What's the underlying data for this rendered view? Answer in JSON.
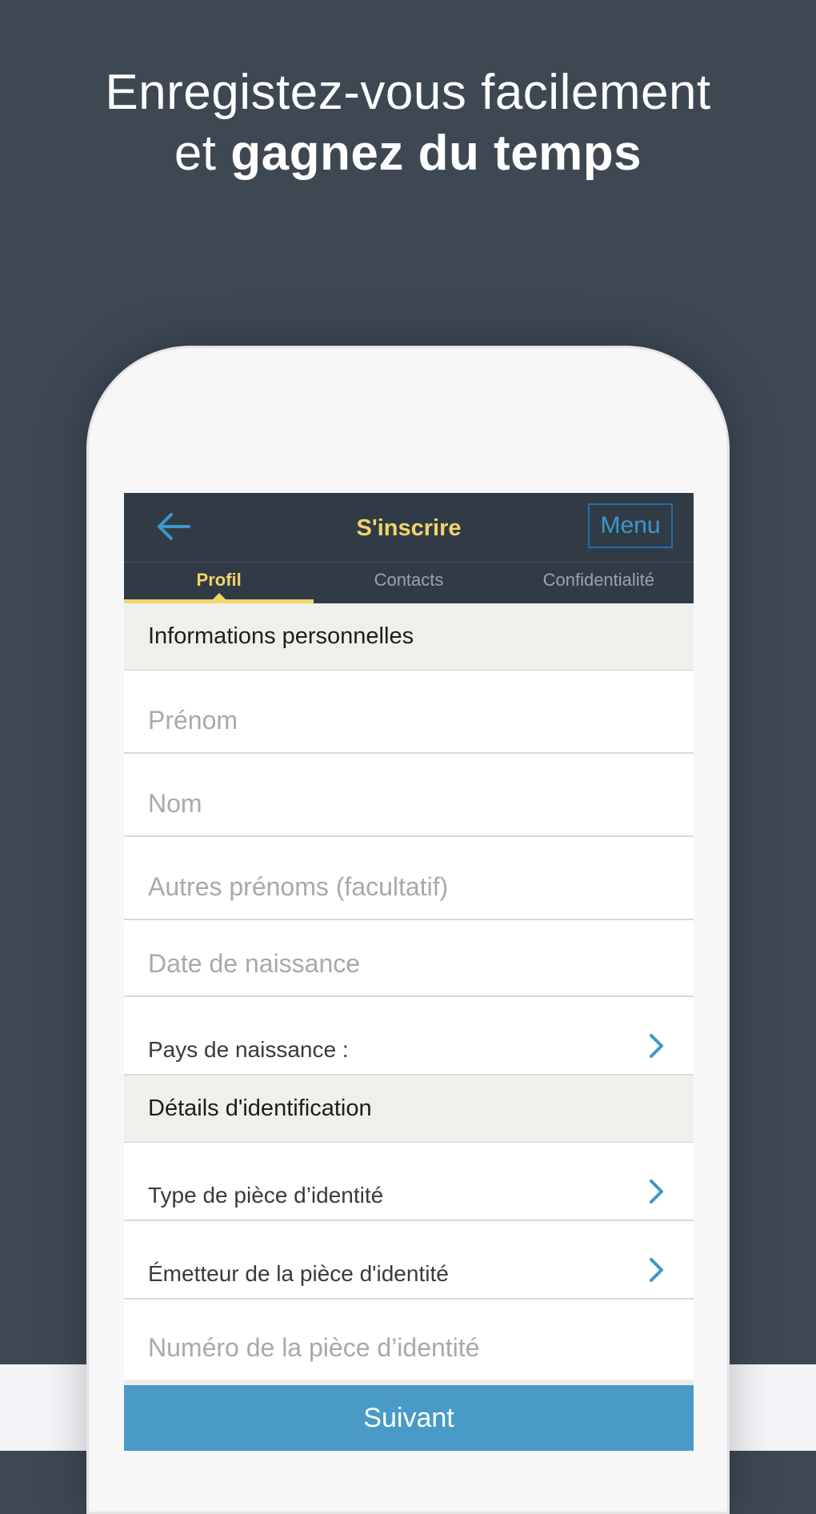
{
  "headline": {
    "line1": "Enregistez-vous facilement",
    "line2_prefix": "et",
    "line2_bold": "gagnez du temps"
  },
  "navbar": {
    "title": "S'inscrire",
    "menu_label": "Menu",
    "back_icon": "arrow-left-icon"
  },
  "tabs": [
    {
      "label": "Profil",
      "active": true
    },
    {
      "label": "Contacts",
      "active": false
    },
    {
      "label": "Confidentialité",
      "active": false
    }
  ],
  "sections": {
    "personal": "Informations personnelles",
    "identification": "Détails d'identification"
  },
  "fields": {
    "first_name": "Prénom",
    "last_name": "Nom",
    "other_names": "Autres prénoms (facultatif)",
    "birth_date": "Date de naissance",
    "birth_country": "Pays de naissance :",
    "id_type": "Type de pièce d’identité",
    "id_issuer": "Émetteur de la pièce d'identité",
    "id_number": "Numéro de la pièce d’identité"
  },
  "next_button": "Suivant",
  "colors": {
    "background": "#3e4853",
    "navbar": "#313b46",
    "accent_yellow": "#f1d56a",
    "accent_blue": "#4a9ac7"
  }
}
